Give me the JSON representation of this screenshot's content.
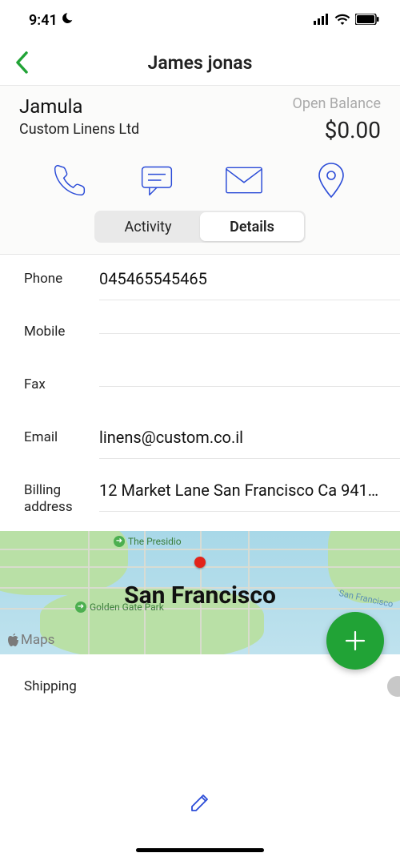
{
  "status": {
    "time": "9:41"
  },
  "nav": {
    "title": "James jonas"
  },
  "contact": {
    "name": "Jamula",
    "company": "Custom Linens Ltd",
    "balance_label": "Open Balance",
    "balance_value": "$0.00"
  },
  "segments": {
    "activity": "Activity",
    "details": "Details"
  },
  "fields": {
    "phone": {
      "label": "Phone",
      "value": "045465545465"
    },
    "mobile": {
      "label": "Mobile",
      "value": ""
    },
    "fax": {
      "label": "Fax",
      "value": ""
    },
    "email": {
      "label": "Email",
      "value": "linens@custom.co.il"
    },
    "billing": {
      "label": "Billing address",
      "value": "12 Market Lane San Francisco Ca 941…"
    },
    "shipping": {
      "label": "Shipping",
      "value": ""
    }
  },
  "map": {
    "city": "San Francisco",
    "poi1": "The Presidio",
    "poi2": "Golden Gate Park",
    "route": "San Francisco",
    "attribution": "Maps"
  },
  "colors": {
    "accent": "#21a336",
    "outline": "#2a4bd7"
  }
}
